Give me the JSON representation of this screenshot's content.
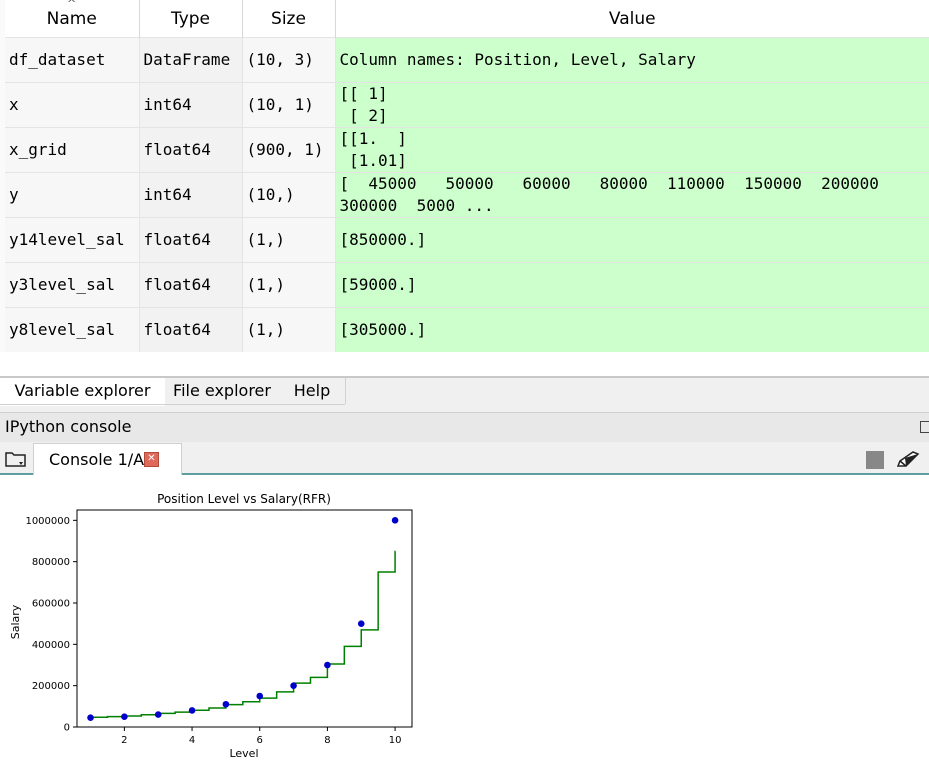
{
  "variable_explorer": {
    "columns": [
      "Name",
      "Type",
      "Size",
      "Value"
    ],
    "rows": [
      {
        "name": "df_dataset",
        "type": "DataFrame",
        "size": "(10, 3)",
        "value": "Column names: Position, Level, Salary"
      },
      {
        "name": "x",
        "type": "int64",
        "size": "(10, 1)",
        "value": "[[ 1]\n [ 2]"
      },
      {
        "name": "x_grid",
        "type": "float64",
        "size": "(900, 1)",
        "value": "[[1.  ]\n [1.01]"
      },
      {
        "name": "y",
        "type": "int64",
        "size": "(10,)",
        "value": "[  45000   50000   60000   80000  110000  150000  200000\n300000  5000 ..."
      },
      {
        "name": "y14level_sal",
        "type": "float64",
        "size": "(1,)",
        "value": "[850000.]"
      },
      {
        "name": "y3level_sal",
        "type": "float64",
        "size": "(1,)",
        "value": "[59000.]"
      },
      {
        "name": "y8level_sal",
        "type": "float64",
        "size": "(1,)",
        "value": "[305000.]"
      }
    ]
  },
  "pane_tabs": [
    "Variable explorer",
    "File explorer",
    "Help"
  ],
  "ipython": {
    "title": "IPython console",
    "console_tab": "Console 1/A"
  },
  "icons": {
    "folder": "folder-icon",
    "close": "close-icon",
    "stop": "stop-icon",
    "clear": "eraser-icon",
    "sort": "sort-arrow-icon",
    "undock": "undock-icon"
  },
  "colors": {
    "value_cell": "#ccffcc",
    "scatter": "#0000cd",
    "line": "#008000"
  },
  "chart_data": {
    "type": "scatter",
    "title": "Position Level vs Salary(RFR)",
    "xlabel": "Level",
    "ylabel": "Salary",
    "xlim": [
      0.6,
      10.5
    ],
    "ylim": [
      0,
      1050000
    ],
    "xticks": [
      2,
      4,
      6,
      8,
      10
    ],
    "yticks": [
      0,
      200000,
      400000,
      600000,
      800000,
      1000000
    ],
    "series": [
      {
        "kind": "scatter",
        "x": [
          1,
          2,
          3,
          4,
          5,
          6,
          7,
          8,
          9,
          10
        ],
        "y": [
          45000,
          50000,
          60000,
          80000,
          110000,
          150000,
          200000,
          300000,
          500000,
          1000000
        ]
      },
      {
        "kind": "step",
        "x": [
          1.0,
          1.5,
          2.0,
          2.5,
          3.0,
          3.5,
          4.0,
          4.5,
          5.0,
          5.5,
          6.0,
          6.5,
          7.0,
          7.5,
          8.0,
          8.5,
          9.0,
          9.5,
          10.0
        ],
        "y": [
          47000,
          50000,
          53000,
          59000,
          66000,
          72000,
          81000,
          92000,
          108000,
          122000,
          140000,
          170000,
          212000,
          240000,
          305000,
          390000,
          470000,
          750000,
          850000
        ]
      }
    ]
  }
}
